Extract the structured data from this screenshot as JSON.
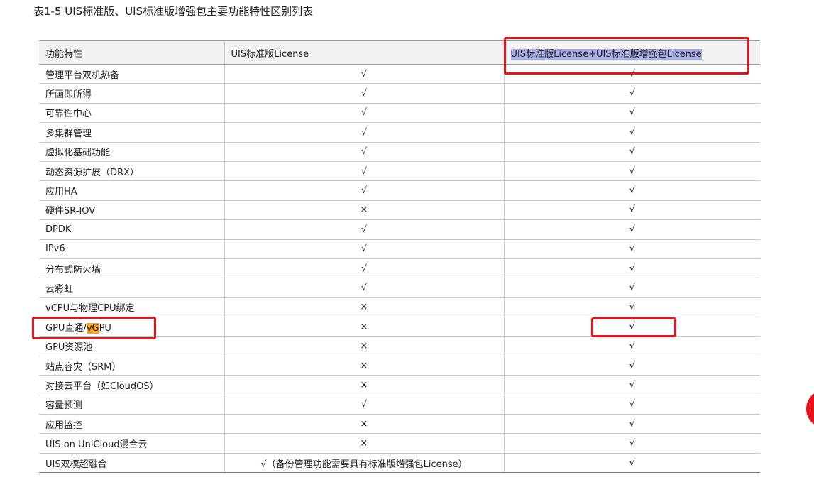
{
  "caption": "表1-5 UIS标准版、UIS标准版增强包主要功能特性区别列表",
  "table": {
    "headers": {
      "feature": "功能特性",
      "standard": "UIS标准版License",
      "enhanced": "UIS标准版License+UIS标准版增强包License"
    },
    "gpu_row": {
      "before": "GPU直通/",
      "highlight": "vG",
      "after": "PU"
    },
    "rows": [
      {
        "feature": "管理平台双机热备",
        "standard": "√",
        "enhanced": "√"
      },
      {
        "feature": "所画即所得",
        "standard": "√",
        "enhanced": "√"
      },
      {
        "feature": "可靠性中心",
        "standard": "√",
        "enhanced": "√"
      },
      {
        "feature": "多集群管理",
        "standard": "√",
        "enhanced": "√"
      },
      {
        "feature": "虚拟化基础功能",
        "standard": "√",
        "enhanced": "√"
      },
      {
        "feature": "动态资源扩展（DRX）",
        "standard": "√",
        "enhanced": "√"
      },
      {
        "feature": "应用HA",
        "standard": "√",
        "enhanced": "√"
      },
      {
        "feature": "硬件SR-IOV",
        "standard": "×",
        "enhanced": "√"
      },
      {
        "feature": "DPDK",
        "standard": "√",
        "enhanced": "√"
      },
      {
        "feature": "IPv6",
        "standard": "√",
        "enhanced": "√"
      },
      {
        "feature": "分布式防火墙",
        "standard": "√",
        "enhanced": "√"
      },
      {
        "feature": "云彩虹",
        "standard": "√",
        "enhanced": "√"
      },
      {
        "feature": "vCPU与物理CPU绑定",
        "standard": "×",
        "enhanced": "√"
      },
      {
        "feature": "GPU直通/vGPU",
        "standard": "×",
        "enhanced": "√"
      },
      {
        "feature": "GPU资源池",
        "standard": "×",
        "enhanced": "√"
      },
      {
        "feature": "站点容灾（SRM）",
        "standard": "×",
        "enhanced": "√"
      },
      {
        "feature": "对接云平台（如CloudOS）",
        "standard": "×",
        "enhanced": "√"
      },
      {
        "feature": "容量预测",
        "standard": "√",
        "enhanced": "√"
      },
      {
        "feature": "应用监控",
        "standard": "×",
        "enhanced": "√"
      },
      {
        "feature": "UIS on UniCloud混合云",
        "standard": "×",
        "enhanced": "√"
      },
      {
        "feature": "UIS双模超融合",
        "standard": "√（备份管理功能需要具有标准版增强包License）",
        "enhanced": "√"
      }
    ]
  },
  "colors": {
    "annotation_red": "#e8131a",
    "selection_blue": "#a9aee8",
    "search_orange": "#f6a533",
    "header_bg": "#f2f2f2"
  }
}
